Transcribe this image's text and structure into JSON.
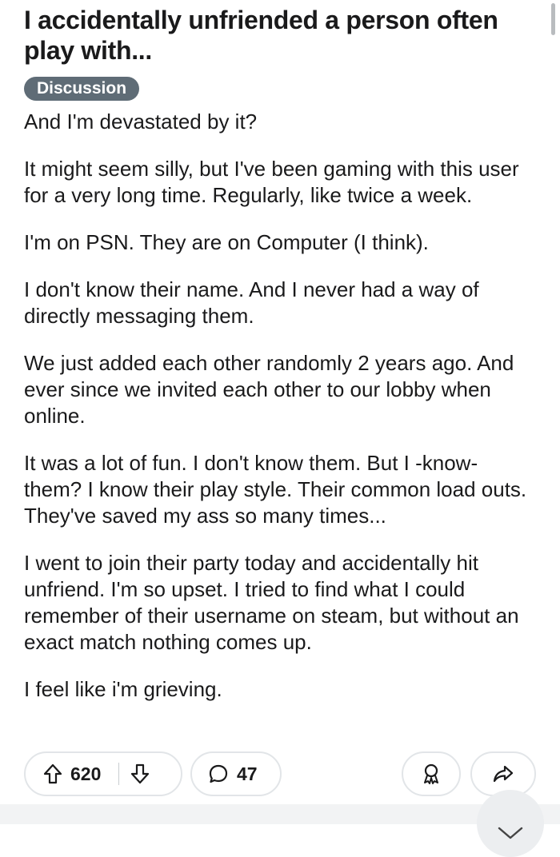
{
  "post": {
    "title": "I accidentally unfriended a person often play with...",
    "flair": "Discussion",
    "body": [
      "And I'm devastated by it?",
      "It might seem silly, but I've been gaming with this user for a very long time. Regularly, like twice a week.",
      "I'm on PSN. They are on Computer (I think).",
      "I don't know their name. And I never had a way of directly messaging them.",
      "We just added each other randomly 2 years ago. And ever since we invited each other to our lobby when online.",
      "It was a lot of fun. I don't know them. But I -know- them? I know their play style. Their common load outs. They've saved my ass so many times...",
      "I went to join their party today and accidentally hit unfriend. I'm so upset. I tried to find what I could remember of their username on steam, but without an exact match nothing comes up.",
      "I feel like i'm grieving."
    ]
  },
  "actions": {
    "vote_count": "620",
    "comment_count": "47",
    "icons": {
      "upvote": "arrow-up-icon",
      "downvote": "arrow-down-icon",
      "comment": "speech-bubble-icon",
      "award": "award-icon",
      "share": "share-arrow-icon",
      "scroll_down": "chevron-down-icon"
    }
  },
  "colors": {
    "flair_background": "#5f6c76",
    "flair_text": "#ffffff",
    "text": "#1a1a1b",
    "pill_border": "#e2e5e8"
  }
}
